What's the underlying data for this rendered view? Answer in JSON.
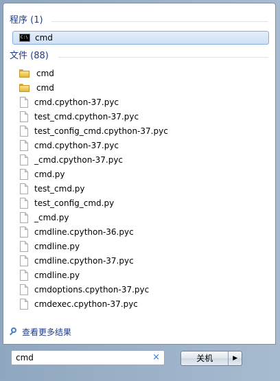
{
  "programs": {
    "header": "程序 (1)",
    "items": [
      {
        "label": "cmd",
        "icon": "cmd-icon",
        "selected": true
      }
    ]
  },
  "files": {
    "header": "文件 (88)",
    "items": [
      {
        "label": "cmd",
        "icon": "folder"
      },
      {
        "label": "cmd",
        "icon": "folder"
      },
      {
        "label": "cmd.cpython-37.pyc",
        "icon": "file"
      },
      {
        "label": "test_cmd.cpython-37.pyc",
        "icon": "file"
      },
      {
        "label": "test_config_cmd.cpython-37.pyc",
        "icon": "file"
      },
      {
        "label": "cmd.cpython-37.pyc",
        "icon": "file"
      },
      {
        "label": "_cmd.cpython-37.pyc",
        "icon": "file"
      },
      {
        "label": "cmd.py",
        "icon": "file"
      },
      {
        "label": "test_cmd.py",
        "icon": "file"
      },
      {
        "label": "test_config_cmd.py",
        "icon": "file"
      },
      {
        "label": "_cmd.py",
        "icon": "file"
      },
      {
        "label": "cmdline.cpython-36.pyc",
        "icon": "file"
      },
      {
        "label": "cmdline.py",
        "icon": "file"
      },
      {
        "label": "cmdline.cpython-37.pyc",
        "icon": "file"
      },
      {
        "label": "cmdline.py",
        "icon": "file"
      },
      {
        "label": "cmdoptions.cpython-37.pyc",
        "icon": "file"
      },
      {
        "label": "cmdexec.cpython-37.pyc",
        "icon": "file"
      }
    ]
  },
  "more_results": "查看更多结果",
  "search": {
    "value": "cmd",
    "clear": "×"
  },
  "shutdown": {
    "label": "关机",
    "arrow": "▶"
  },
  "colors": {
    "header": "#1e3b8a",
    "selection_border": "#84acdd",
    "clear": "#3a78c8"
  }
}
